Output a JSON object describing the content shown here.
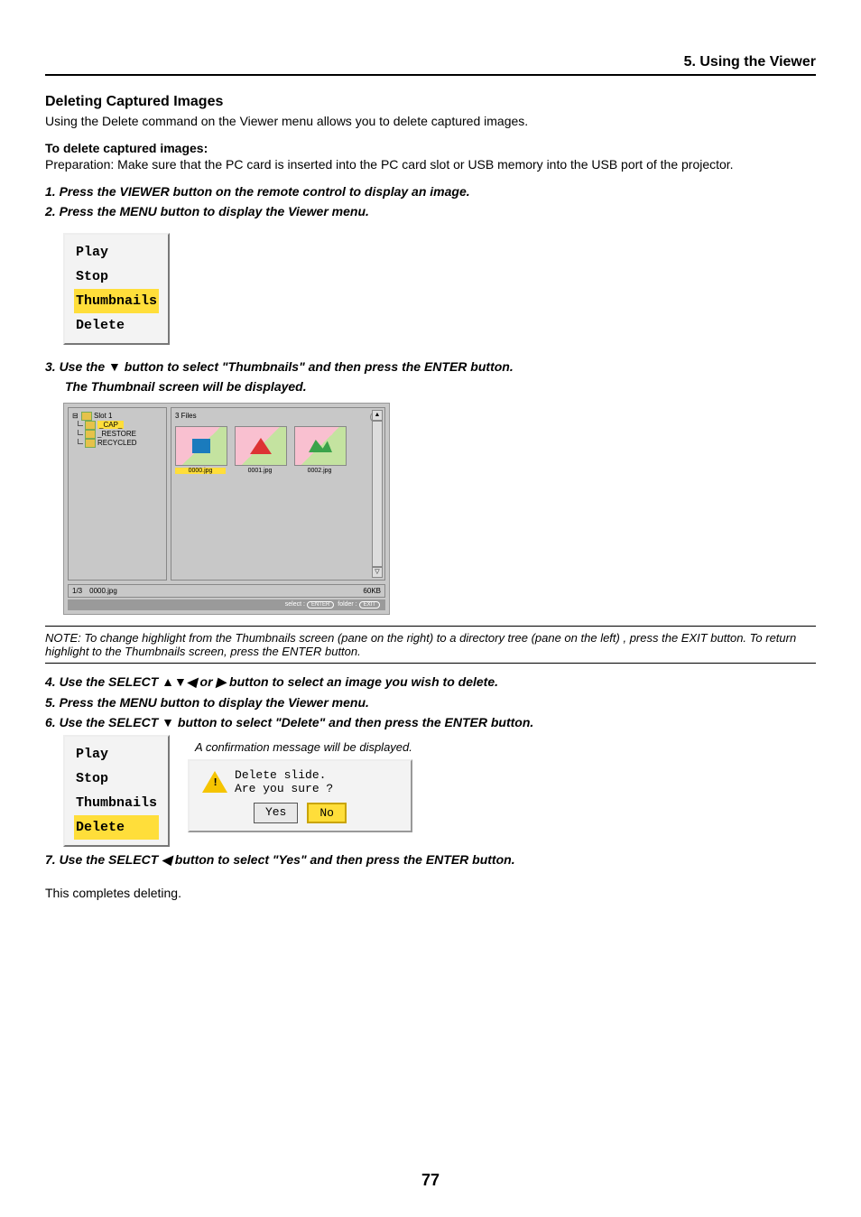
{
  "header": {
    "chapter": "5. Using the Viewer"
  },
  "section": {
    "title": "Deleting Captured Images",
    "intro": "Using the Delete command on the Viewer menu allows you to delete captured images.",
    "sub_heading": "To delete captured images:",
    "prep": "Preparation: Make sure that the PC card is inserted into the PC card slot or USB memory into the USB port of the projector."
  },
  "steps": {
    "s1": "1.  Press the VIEWER button on the remote control to display an image.",
    "s2": "2.  Press the MENU button to display the Viewer menu.",
    "s3": "3.  Use the ▼ button to select \"Thumbnails\" and then press the ENTER button.",
    "s3b": "The Thumbnail screen will be displayed.",
    "s4": "4.  Use the SELECT ▲▼◀ or ▶ button to select an image you wish to delete.",
    "s5": "5.  Press the MENU button to display the Viewer menu.",
    "s6": "6.  Use the SELECT ▼ button to select \"Delete\" and then press the ENTER button.",
    "s7": "7.  Use the SELECT ◀ button to select \"Yes\" and then press the ENTER button."
  },
  "menu1": {
    "items": [
      "Play",
      "Stop",
      "Thumbnails",
      "Delete"
    ],
    "highlight_index": 2
  },
  "menu2": {
    "items": [
      "Play",
      "Stop",
      "Thumbnails",
      "Delete"
    ],
    "highlight_index": 3
  },
  "thumb": {
    "tree": {
      "root": "Slot 1",
      "children": [
        "_CAP_",
        "_RESTORE",
        "RECYCLED"
      ],
      "highlight_index": 0
    },
    "header": "3 Files",
    "help": "?",
    "files": [
      "0000.jpg",
      "0001.jpg",
      "0002.jpg"
    ],
    "selected_index": 0,
    "info": {
      "counter": "1/3",
      "name": "0000.jpg",
      "size": "60KB"
    },
    "hint": {
      "select_label": "select :",
      "select_key": "ENTER",
      "folder_label": "folder :",
      "folder_key": "EXIT"
    }
  },
  "note": "NOTE: To change highlight from the Thumbnails screen (pane on the right) to a directory tree (pane on the left) , press the EXIT button. To return highlight to the Thumbnails screen, press the ENTER button.",
  "confirm": {
    "caption": "A confirmation message will be displayed.",
    "line1": "Delete slide.",
    "line2": "Are you sure ?",
    "yes": "Yes",
    "no": "No"
  },
  "closing": "This completes deleting.",
  "page_number": "77"
}
